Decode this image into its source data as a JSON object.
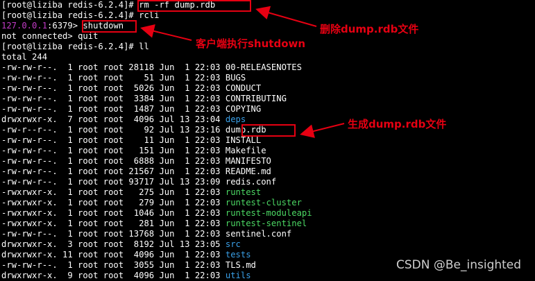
{
  "terminal": {
    "lines": [
      [
        {
          "t": "[root@liziba redis-6.2.4]# ",
          "c": "white"
        },
        {
          "t": "rm -rf dump.rdb",
          "c": "white"
        }
      ],
      [
        {
          "t": "[root@liziba redis-6.2.4]# rcli",
          "c": "white"
        }
      ],
      [
        {
          "t": "127.0.0.1",
          "c": "magenta"
        },
        {
          "t": ":6379> ",
          "c": "white"
        },
        {
          "t": "shutdown",
          "c": "white"
        }
      ],
      [
        {
          "t": "not connected",
          "c": "white"
        },
        {
          "t": "> quit",
          "c": "white"
        }
      ],
      [
        {
          "t": "[root@liziba redis-6.2.4]# ll",
          "c": "white"
        }
      ],
      [
        {
          "t": "total 244",
          "c": "white"
        }
      ],
      [
        {
          "t": "-rw-rw-r--.  1 root root 28118 Jun  1 22:03 ",
          "c": "white"
        },
        {
          "t": "00-RELEASENOTES",
          "c": "white"
        }
      ],
      [
        {
          "t": "-rw-rw-r--.  1 root root    51 Jun  1 22:03 ",
          "c": "white"
        },
        {
          "t": "BUGS",
          "c": "white"
        }
      ],
      [
        {
          "t": "-rw-rw-r--.  1 root root  5026 Jun  1 22:03 ",
          "c": "white"
        },
        {
          "t": "CONDUCT",
          "c": "white"
        }
      ],
      [
        {
          "t": "-rw-rw-r--.  1 root root  3384 Jun  1 22:03 ",
          "c": "white"
        },
        {
          "t": "CONTRIBUTING",
          "c": "white"
        }
      ],
      [
        {
          "t": "-rw-rw-r--.  1 root root  1487 Jun  1 22:03 ",
          "c": "white"
        },
        {
          "t": "COPYING",
          "c": "white"
        }
      ],
      [
        {
          "t": "drwxrwxr-x.  7 root root  4096 Jul 13 23:04 ",
          "c": "white"
        },
        {
          "t": "deps",
          "c": "dir"
        }
      ],
      [
        {
          "t": "-rw-r--r--.  1 root root    92 Jul 13 23:16 ",
          "c": "white"
        },
        {
          "t": "dump.rdb",
          "c": "white"
        }
      ],
      [
        {
          "t": "-rw-rw-r--.  1 root root    11 Jun  1 22:03 ",
          "c": "white"
        },
        {
          "t": "INSTALL",
          "c": "white"
        }
      ],
      [
        {
          "t": "-rw-rw-r--.  1 root root   151 Jun  1 22:03 ",
          "c": "white"
        },
        {
          "t": "Makefile",
          "c": "white"
        }
      ],
      [
        {
          "t": "-rw-rw-r--.  1 root root  6888 Jun  1 22:03 ",
          "c": "white"
        },
        {
          "t": "MANIFESTO",
          "c": "white"
        }
      ],
      [
        {
          "t": "-rw-rw-r--.  1 root root 21567 Jun  1 22:03 ",
          "c": "white"
        },
        {
          "t": "README.md",
          "c": "white"
        }
      ],
      [
        {
          "t": "-rw-rw-r--.  1 root root 93717 Jul 13 23:09 ",
          "c": "white"
        },
        {
          "t": "redis.conf",
          "c": "white"
        }
      ],
      [
        {
          "t": "-rwxrwxr-x.  1 root root   275 Jun  1 22:03 ",
          "c": "white"
        },
        {
          "t": "runtest",
          "c": "green"
        }
      ],
      [
        {
          "t": "-rwxrwxr-x.  1 root root   279 Jun  1 22:03 ",
          "c": "white"
        },
        {
          "t": "runtest-cluster",
          "c": "green"
        }
      ],
      [
        {
          "t": "-rwxrwxr-x.  1 root root  1046 Jun  1 22:03 ",
          "c": "white"
        },
        {
          "t": "runtest-moduleapi",
          "c": "green"
        }
      ],
      [
        {
          "t": "-rwxrwxr-x.  1 root root   281 Jun  1 22:03 ",
          "c": "white"
        },
        {
          "t": "runtest-sentinel",
          "c": "green"
        }
      ],
      [
        {
          "t": "-rw-rw-r--.  1 root root 13768 Jun  1 22:03 ",
          "c": "white"
        },
        {
          "t": "sentinel.conf",
          "c": "white"
        }
      ],
      [
        {
          "t": "drwxrwxr-x.  3 root root  8192 Jul 13 23:05 ",
          "c": "white"
        },
        {
          "t": "src",
          "c": "dir"
        }
      ],
      [
        {
          "t": "drwxrwxr-x. 11 root root  4096 Jun  1 22:03 ",
          "c": "white"
        },
        {
          "t": "tests",
          "c": "dir"
        }
      ],
      [
        {
          "t": "-rw-rw-r--.  1 root root  3055 Jun  1 22:03 ",
          "c": "white"
        },
        {
          "t": "TLS.md",
          "c": "white"
        }
      ],
      [
        {
          "t": "drwxrwxr-x.  9 root root  4096 Jun  1 22:03 ",
          "c": "white"
        },
        {
          "t": "utils",
          "c": "dir"
        }
      ]
    ]
  },
  "annotations": {
    "delete_dump": "删除dump.rdb文件",
    "client_shutdown": "客户端执行shutdown",
    "generated_dump": "生成dump.rdb文件"
  },
  "watermark": "CSDN @Be_insighted",
  "colors": {
    "background": "#000000",
    "text": "#ffffff",
    "prompt_host": "#c23bc7",
    "executable": "#4cd964",
    "directory": "#3aa0e8",
    "annotation": "#e60012"
  }
}
